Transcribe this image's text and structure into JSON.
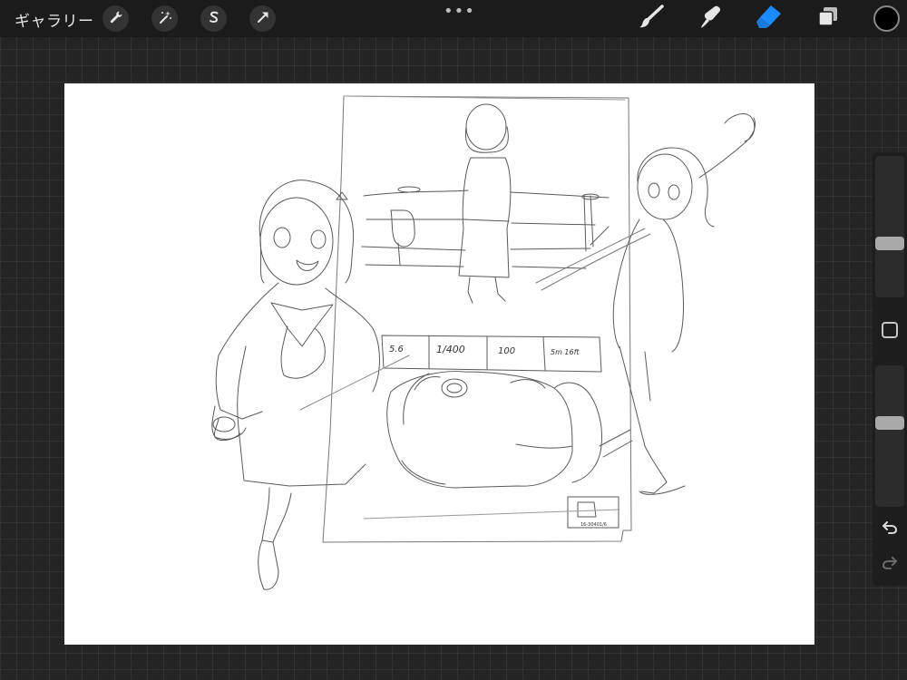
{
  "app": {
    "gallery_label": "ギャラリー",
    "more_dots": "•••"
  },
  "toolbar_left": [
    {
      "name": "actions",
      "icon": "wrench-icon"
    },
    {
      "name": "adjustments",
      "icon": "magic-wand-icon"
    },
    {
      "name": "selection",
      "icon": "selection-s-icon"
    },
    {
      "name": "transform",
      "icon": "arrow-cursor-icon"
    }
  ],
  "toolbar_right": [
    {
      "name": "brush",
      "icon": "brush-icon",
      "active": false
    },
    {
      "name": "smudge",
      "icon": "smudge-icon",
      "active": false
    },
    {
      "name": "eraser",
      "icon": "eraser-icon",
      "active": true
    },
    {
      "name": "layers",
      "icon": "layers-icon",
      "active": false
    }
  ],
  "current_color": "#000000",
  "accent_color": "#1a8cff",
  "sidebar": {
    "size_slider_level": 0.37,
    "opacity_slider_level": 0.6
  },
  "sketch": {
    "exposure_labels": [
      "5.6",
      "1/400",
      "100",
      "5m 16ft"
    ],
    "signature_text": "16-30401/6"
  }
}
